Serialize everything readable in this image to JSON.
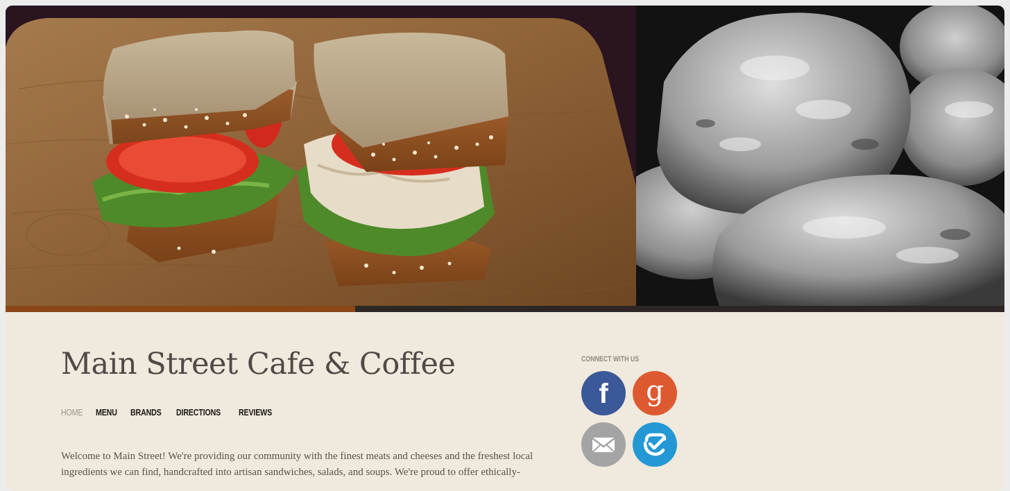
{
  "colors": {
    "page_background": "#f0e9dd",
    "progress_fill": "#8a4615",
    "progress_track": "#2c2724",
    "facebook": "#3b5998",
    "google": "#dd5a30",
    "email": "#a4a4a4",
    "foursquare": "#2398d4"
  },
  "hero": {
    "slides": [
      "sandwich-photo",
      "bread-photo"
    ],
    "progress": 0.35
  },
  "site": {
    "title": "Main Street Cafe & Coffee"
  },
  "nav": {
    "items": [
      {
        "label": "Home",
        "active": true
      },
      {
        "label": "Menu",
        "active": false
      },
      {
        "label": "Brands",
        "active": false
      },
      {
        "label": "Directions",
        "active": false
      },
      {
        "label": "Reviews",
        "active": false
      }
    ]
  },
  "intro": {
    "text": "Welcome to Main Street! We're providing our community with the finest meats and cheeses and the freshest local ingredients we can find, handcrafted into artisan sandwiches, salads, and soups. We're proud to offer ethically-"
  },
  "connect": {
    "heading": "Connect with us",
    "buttons": [
      {
        "icon": "facebook-icon",
        "label": "f"
      },
      {
        "icon": "google-icon",
        "label": "g"
      },
      {
        "icon": "email-icon"
      },
      {
        "icon": "foursquare-icon"
      }
    ]
  }
}
